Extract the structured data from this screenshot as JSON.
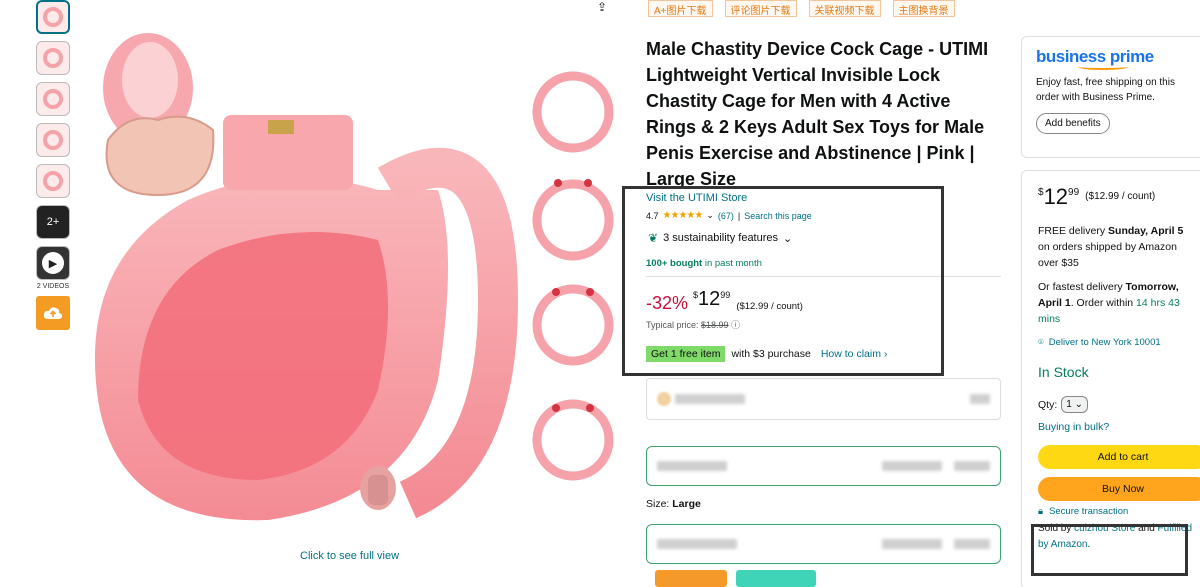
{
  "thumbnails": {
    "count_label": "2+",
    "videos_label": "2 VIDEOS"
  },
  "main": {
    "click_to_view": "Click to see full view"
  },
  "tags": [
    "A+图片下载",
    "评论图片下载",
    "关联视频下载",
    "主图换背景"
  ],
  "product": {
    "title": "Male Chastity Device Cock Cage - UTIMI Lightweight Vertical Invisible Lock Chastity Cage for Men with 4 Active Rings & 2 Keys Adult Sex Toys for Male Penis Exercise and Abstinence | Pink | Large Size",
    "store_link": "Visit the UTIMI Store",
    "rating": "4.7",
    "stars": "★★★★★",
    "rating_count": "(67)",
    "search_page": "Search this page",
    "sustainability": "3 sustainability features",
    "bought_bold": "100+ bought",
    "bought_rest": " in past month",
    "discount": "-32%",
    "price_dollar": "$",
    "price_whole": "12",
    "price_cents": "99",
    "price_per_count": "($12.99 / count)",
    "typical_label": "Typical price: ",
    "typical_price": "$18.99",
    "free_item": "Get 1 free item",
    "free_condition": "with $3 purchase",
    "how_to_claim": "How to claim ›",
    "size_label": "Size: ",
    "size_value": "Large"
  },
  "business_prime": {
    "logo": "business prime",
    "text": "Enjoy fast, free shipping on this order with Business Prime.",
    "button": "Add benefits"
  },
  "buybox": {
    "dollar": "$",
    "whole": "12",
    "cents": "99",
    "per_count": "($12.99 / count)",
    "delivery_pre": "FREE delivery ",
    "delivery_date": "Sunday, April 5",
    "delivery_post": " on orders shipped by Amazon over $35",
    "fastest_pre": "Or fastest delivery ",
    "fastest_date": "Tomorrow, April 1",
    "fastest_mid": ". Order within ",
    "fastest_time": "14 hrs 43 mins",
    "deliver_to": "Deliver to New York 10001",
    "in_stock": "In Stock",
    "qty_label": "Qty:",
    "qty_value": "1",
    "bulk": "Buying in bulk?",
    "add_to_cart": "Add to cart",
    "buy_now": "Buy Now",
    "secure": "Secure transaction",
    "sold_pre": "Sold by ",
    "sold_by": "cuizhou Store",
    "sold_mid": " and ",
    "fulfilled": "Fulfilled by Amazon",
    "sold_end": "."
  },
  "colors": {
    "link": "#007185",
    "deal": "#cc0c39",
    "green": "#067d62",
    "cart": "#ffd814",
    "buy": "#ffa41c"
  }
}
